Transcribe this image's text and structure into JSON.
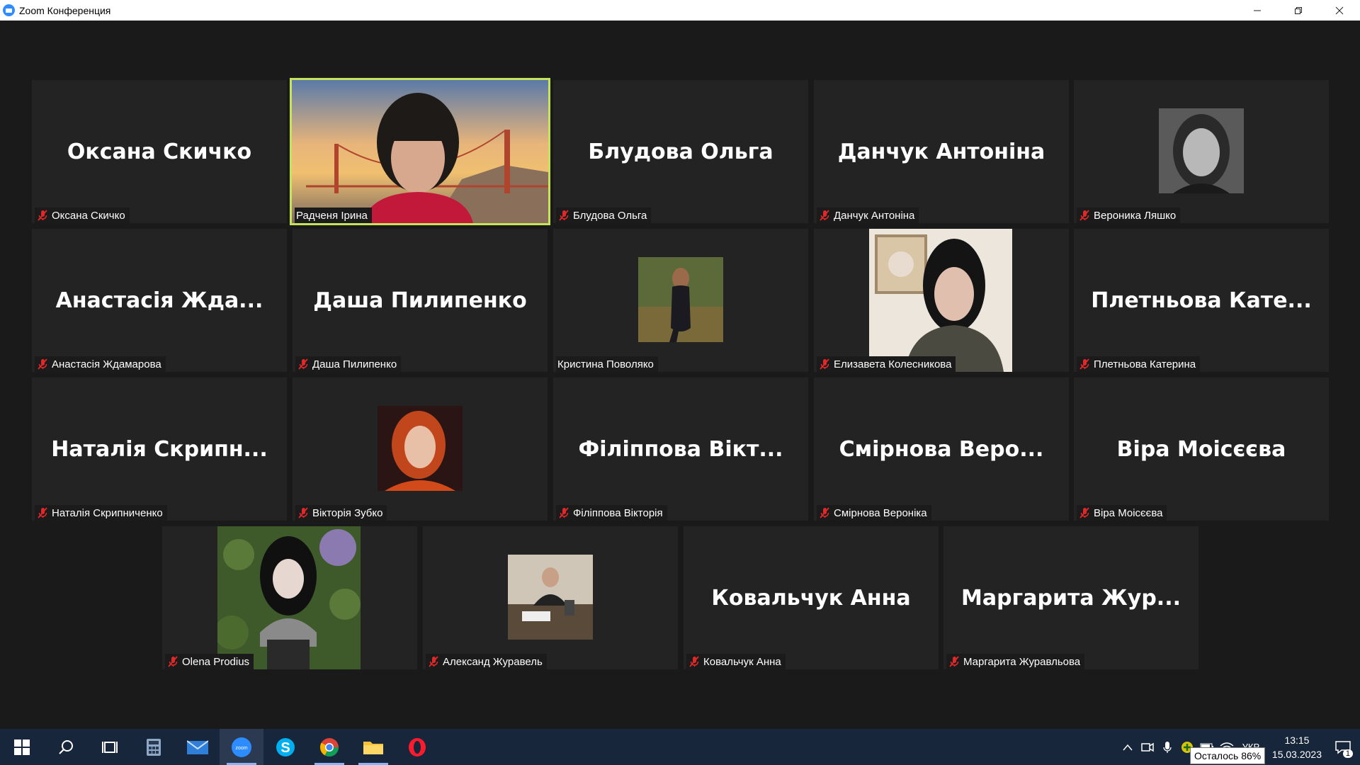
{
  "window": {
    "title": "Zoom Конференция",
    "controls": [
      "minimize-icon",
      "restore-icon",
      "close-icon"
    ]
  },
  "meeting": {
    "active_speaker_color": "#c7e35b",
    "row1": [
      {
        "big": "Оксана Скичко",
        "label": "Оксана Скичко",
        "muted": true
      },
      {
        "big": "",
        "label": "Радченя Ірина",
        "muted": false,
        "video": true
      },
      {
        "big": "Блудова Ольга",
        "label": "Блудова Ольга",
        "muted": true
      },
      {
        "big": "Данчук Антоніна",
        "label": "Данчук Антоніна",
        "muted": true
      },
      {
        "big": "",
        "label": "Вероника Ляшко",
        "muted": true,
        "photo": true
      }
    ],
    "row2": [
      {
        "big": "Анастасія Жда...",
        "label": "Анастасія Ждамарова",
        "muted": true
      },
      {
        "big": "Даша Пилипенко",
        "label": "Даша Пилипенко",
        "muted": true
      },
      {
        "big": "",
        "label": "Кристина Поволяко",
        "muted": false,
        "photo": true
      },
      {
        "big": "",
        "label": "Елизавета Колесникова",
        "muted": true,
        "photo": true
      },
      {
        "big": "Плетньова Кате...",
        "label": "Плетньова Катерина",
        "muted": true
      }
    ],
    "row3": [
      {
        "big": "Наталія Скрипн...",
        "label": "Наталія Скрипниченко",
        "muted": true
      },
      {
        "big": "",
        "label": "Вікторія Зубко",
        "muted": true,
        "photo": true
      },
      {
        "big": "Філіппова Вікт...",
        "label": "Філіппова Вікторія",
        "muted": true
      },
      {
        "big": "Смірнова Веро...",
        "label": "Смірнова Вероніка",
        "muted": true
      },
      {
        "big": "Віра Моісєєва",
        "label": "Віра Моісєєва",
        "muted": true
      }
    ],
    "row4": [
      {
        "big": "",
        "label": "Olena Prodius",
        "muted": true,
        "photo": true
      },
      {
        "big": "",
        "label": "Александ Журавель",
        "muted": true,
        "photo": true
      },
      {
        "big": "Ковальчук Анна",
        "label": "Ковальчук Анна",
        "muted": true
      },
      {
        "big": "Маргарита Жур...",
        "label": "Маргарита Журавльова",
        "muted": true
      }
    ]
  },
  "taskbar": {
    "apps": [
      "windows-start-icon",
      "search-icon",
      "task-view-icon",
      "calculator-icon",
      "mail-icon",
      "zoom-icon",
      "skype-icon",
      "chrome-icon",
      "file-explorer-icon",
      "opera-icon"
    ],
    "tray": {
      "lang": "УКР",
      "time": "13:15",
      "date": "15.03.2023",
      "notifications": "1",
      "battery_tooltip": "Осталось 86%"
    }
  }
}
